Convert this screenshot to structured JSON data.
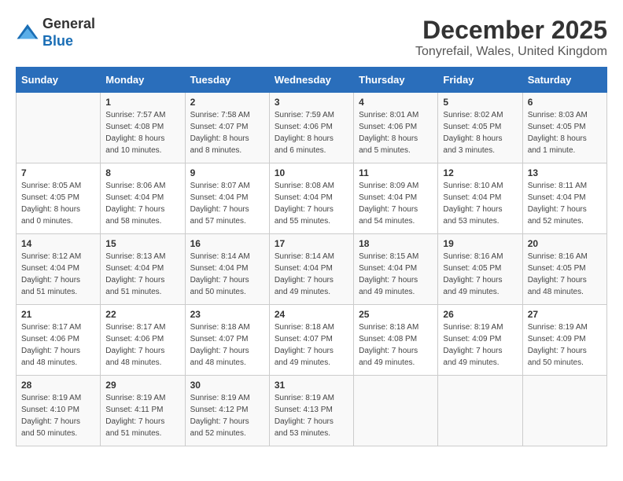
{
  "logo": {
    "general": "General",
    "blue": "Blue"
  },
  "title": "December 2025",
  "subtitle": "Tonyrefail, Wales, United Kingdom",
  "calendar": {
    "headers": [
      "Sunday",
      "Monday",
      "Tuesday",
      "Wednesday",
      "Thursday",
      "Friday",
      "Saturday"
    ],
    "weeks": [
      [
        {
          "day": "",
          "sunrise": "",
          "sunset": "",
          "daylight": ""
        },
        {
          "day": "1",
          "sunrise": "Sunrise: 7:57 AM",
          "sunset": "Sunset: 4:08 PM",
          "daylight": "Daylight: 8 hours and 10 minutes."
        },
        {
          "day": "2",
          "sunrise": "Sunrise: 7:58 AM",
          "sunset": "Sunset: 4:07 PM",
          "daylight": "Daylight: 8 hours and 8 minutes."
        },
        {
          "day": "3",
          "sunrise": "Sunrise: 7:59 AM",
          "sunset": "Sunset: 4:06 PM",
          "daylight": "Daylight: 8 hours and 6 minutes."
        },
        {
          "day": "4",
          "sunrise": "Sunrise: 8:01 AM",
          "sunset": "Sunset: 4:06 PM",
          "daylight": "Daylight: 8 hours and 5 minutes."
        },
        {
          "day": "5",
          "sunrise": "Sunrise: 8:02 AM",
          "sunset": "Sunset: 4:05 PM",
          "daylight": "Daylight: 8 hours and 3 minutes."
        },
        {
          "day": "6",
          "sunrise": "Sunrise: 8:03 AM",
          "sunset": "Sunset: 4:05 PM",
          "daylight": "Daylight: 8 hours and 1 minute."
        }
      ],
      [
        {
          "day": "7",
          "sunrise": "Sunrise: 8:05 AM",
          "sunset": "Sunset: 4:05 PM",
          "daylight": "Daylight: 8 hours and 0 minutes."
        },
        {
          "day": "8",
          "sunrise": "Sunrise: 8:06 AM",
          "sunset": "Sunset: 4:04 PM",
          "daylight": "Daylight: 7 hours and 58 minutes."
        },
        {
          "day": "9",
          "sunrise": "Sunrise: 8:07 AM",
          "sunset": "Sunset: 4:04 PM",
          "daylight": "Daylight: 7 hours and 57 minutes."
        },
        {
          "day": "10",
          "sunrise": "Sunrise: 8:08 AM",
          "sunset": "Sunset: 4:04 PM",
          "daylight": "Daylight: 7 hours and 55 minutes."
        },
        {
          "day": "11",
          "sunrise": "Sunrise: 8:09 AM",
          "sunset": "Sunset: 4:04 PM",
          "daylight": "Daylight: 7 hours and 54 minutes."
        },
        {
          "day": "12",
          "sunrise": "Sunrise: 8:10 AM",
          "sunset": "Sunset: 4:04 PM",
          "daylight": "Daylight: 7 hours and 53 minutes."
        },
        {
          "day": "13",
          "sunrise": "Sunrise: 8:11 AM",
          "sunset": "Sunset: 4:04 PM",
          "daylight": "Daylight: 7 hours and 52 minutes."
        }
      ],
      [
        {
          "day": "14",
          "sunrise": "Sunrise: 8:12 AM",
          "sunset": "Sunset: 4:04 PM",
          "daylight": "Daylight: 7 hours and 51 minutes."
        },
        {
          "day": "15",
          "sunrise": "Sunrise: 8:13 AM",
          "sunset": "Sunset: 4:04 PM",
          "daylight": "Daylight: 7 hours and 51 minutes."
        },
        {
          "day": "16",
          "sunrise": "Sunrise: 8:14 AM",
          "sunset": "Sunset: 4:04 PM",
          "daylight": "Daylight: 7 hours and 50 minutes."
        },
        {
          "day": "17",
          "sunrise": "Sunrise: 8:14 AM",
          "sunset": "Sunset: 4:04 PM",
          "daylight": "Daylight: 7 hours and 49 minutes."
        },
        {
          "day": "18",
          "sunrise": "Sunrise: 8:15 AM",
          "sunset": "Sunset: 4:04 PM",
          "daylight": "Daylight: 7 hours and 49 minutes."
        },
        {
          "day": "19",
          "sunrise": "Sunrise: 8:16 AM",
          "sunset": "Sunset: 4:05 PM",
          "daylight": "Daylight: 7 hours and 49 minutes."
        },
        {
          "day": "20",
          "sunrise": "Sunrise: 8:16 AM",
          "sunset": "Sunset: 4:05 PM",
          "daylight": "Daylight: 7 hours and 48 minutes."
        }
      ],
      [
        {
          "day": "21",
          "sunrise": "Sunrise: 8:17 AM",
          "sunset": "Sunset: 4:06 PM",
          "daylight": "Daylight: 7 hours and 48 minutes."
        },
        {
          "day": "22",
          "sunrise": "Sunrise: 8:17 AM",
          "sunset": "Sunset: 4:06 PM",
          "daylight": "Daylight: 7 hours and 48 minutes."
        },
        {
          "day": "23",
          "sunrise": "Sunrise: 8:18 AM",
          "sunset": "Sunset: 4:07 PM",
          "daylight": "Daylight: 7 hours and 48 minutes."
        },
        {
          "day": "24",
          "sunrise": "Sunrise: 8:18 AM",
          "sunset": "Sunset: 4:07 PM",
          "daylight": "Daylight: 7 hours and 49 minutes."
        },
        {
          "day": "25",
          "sunrise": "Sunrise: 8:18 AM",
          "sunset": "Sunset: 4:08 PM",
          "daylight": "Daylight: 7 hours and 49 minutes."
        },
        {
          "day": "26",
          "sunrise": "Sunrise: 8:19 AM",
          "sunset": "Sunset: 4:09 PM",
          "daylight": "Daylight: 7 hours and 49 minutes."
        },
        {
          "day": "27",
          "sunrise": "Sunrise: 8:19 AM",
          "sunset": "Sunset: 4:09 PM",
          "daylight": "Daylight: 7 hours and 50 minutes."
        }
      ],
      [
        {
          "day": "28",
          "sunrise": "Sunrise: 8:19 AM",
          "sunset": "Sunset: 4:10 PM",
          "daylight": "Daylight: 7 hours and 50 minutes."
        },
        {
          "day": "29",
          "sunrise": "Sunrise: 8:19 AM",
          "sunset": "Sunset: 4:11 PM",
          "daylight": "Daylight: 7 hours and 51 minutes."
        },
        {
          "day": "30",
          "sunrise": "Sunrise: 8:19 AM",
          "sunset": "Sunset: 4:12 PM",
          "daylight": "Daylight: 7 hours and 52 minutes."
        },
        {
          "day": "31",
          "sunrise": "Sunrise: 8:19 AM",
          "sunset": "Sunset: 4:13 PM",
          "daylight": "Daylight: 7 hours and 53 minutes."
        },
        {
          "day": "",
          "sunrise": "",
          "sunset": "",
          "daylight": ""
        },
        {
          "day": "",
          "sunrise": "",
          "sunset": "",
          "daylight": ""
        },
        {
          "day": "",
          "sunrise": "",
          "sunset": "",
          "daylight": ""
        }
      ]
    ]
  }
}
